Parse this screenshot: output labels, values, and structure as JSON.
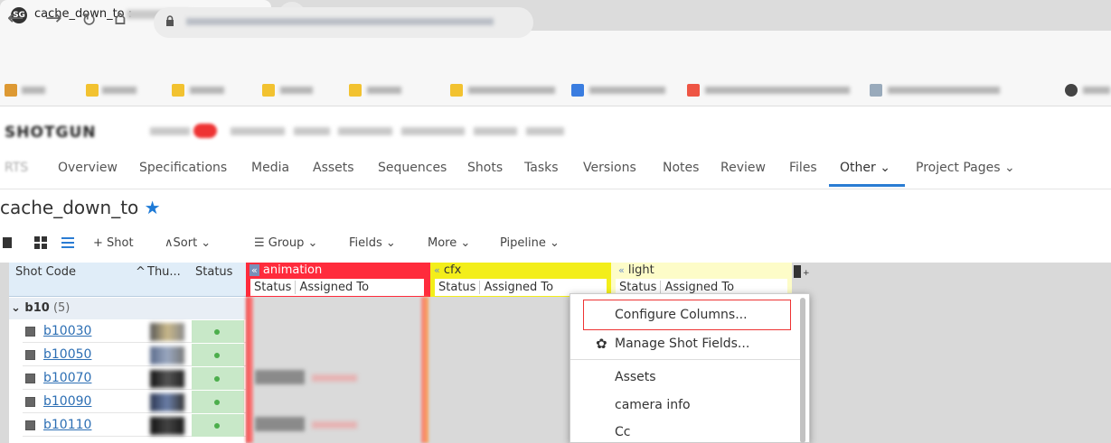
{
  "browser": {
    "tab_title": "cache_down_to :",
    "favicon": "SG",
    "close_glyph": "×",
    "new_tab_glyph": "+"
  },
  "project_tabs": [
    {
      "label": "Overview"
    },
    {
      "label": "Specifications"
    },
    {
      "label": "Media"
    },
    {
      "label": "Assets"
    },
    {
      "label": "Sequences"
    },
    {
      "label": "Shots"
    },
    {
      "label": "Tasks"
    },
    {
      "label": "Versions"
    },
    {
      "label": "Notes"
    },
    {
      "label": "Review"
    },
    {
      "label": "Files"
    },
    {
      "label": "Other ⌄"
    },
    {
      "label": "Project Pages ⌄"
    }
  ],
  "project_tab_prefix": "RTS",
  "page": {
    "title": "cache_down_to",
    "star": "★"
  },
  "toolbar": {
    "shot": "+ Shot",
    "sort": "∧Sort ⌄",
    "group": "Group ⌄",
    "fields": "Fields ⌄",
    "more": "More ⌄",
    "pipeline": "Pipeline ⌄"
  },
  "grid": {
    "headers": {
      "shot_code": "Shot Code",
      "sort_glyph": "^",
      "thumbnail": "Thu...",
      "status": "Status"
    },
    "groups": [
      {
        "name": "animation",
        "color": "#ff2b3c",
        "collapse": "«",
        "cols": [
          "Status",
          "Assigned To"
        ]
      },
      {
        "name": "cfx",
        "color": "#f3ee1a",
        "collapse": "«",
        "cols": [
          "Status",
          "Assigned To"
        ]
      },
      {
        "name": "light",
        "color": "#fdfcc8",
        "collapse": "«",
        "cols": [
          "Status",
          "Assigned To"
        ]
      }
    ],
    "group_row": {
      "label": "⌄ b10",
      "count": "(5)"
    },
    "rows": [
      {
        "code": "b10030"
      },
      {
        "code": "b10050"
      },
      {
        "code": "b10070"
      },
      {
        "code": "b10090"
      },
      {
        "code": "b10110"
      }
    ]
  },
  "menu": {
    "configure_columns": "Configure Columns...",
    "manage_shot_fields": "Manage Shot Fields...",
    "items": [
      "Assets",
      "camera info",
      "Cc"
    ]
  }
}
